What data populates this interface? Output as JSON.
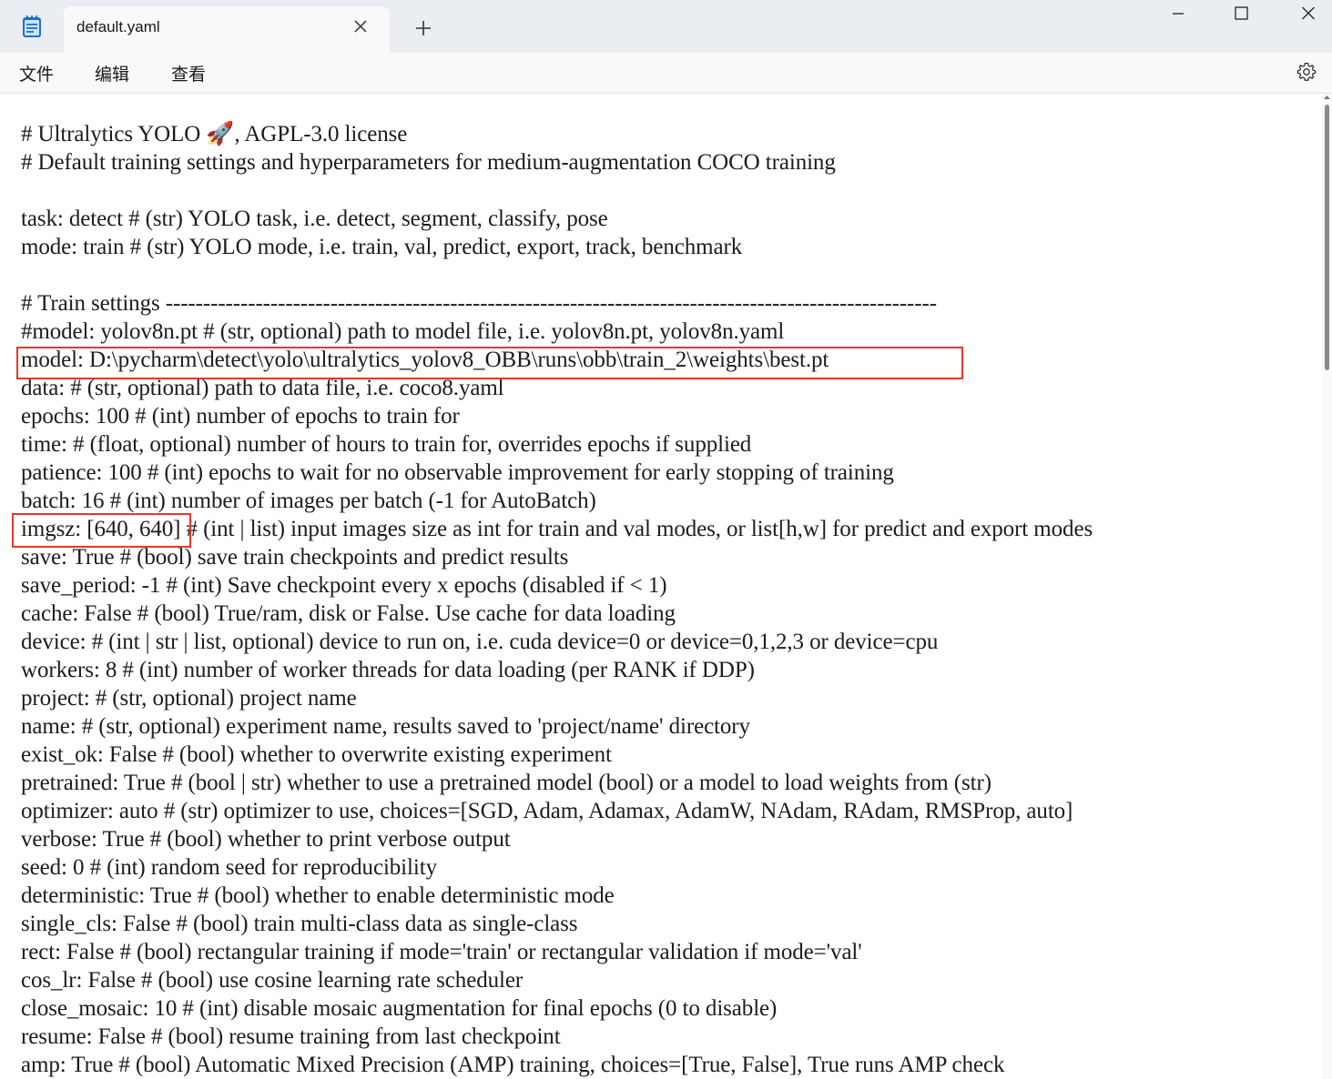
{
  "titlebar": {
    "tab_title": "default.yaml",
    "new_tab_symbol": "+",
    "icons": [
      "notepad-app-icon",
      "close-icon",
      "plus-icon",
      "minimize-icon",
      "maximize-icon",
      "window-close-icon"
    ]
  },
  "menu": {
    "file": "文件",
    "edit": "编辑",
    "view": "查看",
    "settings_icon": "gear-icon"
  },
  "highlight_color": "#e53a23",
  "editor": {
    "lines": [
      "# Ultralytics YOLO 🚀, AGPL-3.0 license",
      "# Default training settings and hyperparameters for medium-augmentation COCO training",
      "",
      "task: detect # (str) YOLO task, i.e. detect, segment, classify, pose",
      "mode: train # (str) YOLO mode, i.e. train, val, predict, export, track, benchmark",
      "",
      "# Train settings -------------------------------------------------------------------------------------------------------",
      "#model: yolov8n.pt # (str, optional) path to model file, i.e. yolov8n.pt, yolov8n.yaml",
      "model: D:\\pycharm\\detect\\yolo\\ultralytics_yolov8_OBB\\runs\\obb\\train_2\\weights\\best.pt",
      "data: # (str, optional) path to data file, i.e. coco8.yaml",
      "epochs: 100 # (int) number of epochs to train for",
      "time: # (float, optional) number of hours to train for, overrides epochs if supplied",
      "patience: 100 # (int) epochs to wait for no observable improvement for early stopping of training",
      "batch: 16 # (int) number of images per batch (-1 for AutoBatch)",
      "imgsz: [640, 640] # (int | list) input images size as int for train and val modes, or list[h,w] for predict and export modes",
      "save: True # (bool) save train checkpoints and predict results",
      "save_period: -1 # (int) Save checkpoint every x epochs (disabled if < 1)",
      "cache: False # (bool) True/ram, disk or False. Use cache for data loading",
      "device: # (int | str | list, optional) device to run on, i.e. cuda device=0 or device=0,1,2,3 or device=cpu",
      "workers: 8 # (int) number of worker threads for data loading (per RANK if DDP)",
      "project: # (str, optional) project name",
      "name: # (str, optional) experiment name, results saved to 'project/name' directory",
      "exist_ok: False # (bool) whether to overwrite existing experiment",
      "pretrained: True # (bool | str) whether to use a pretrained model (bool) or a model to load weights from (str)",
      "optimizer: auto # (str) optimizer to use, choices=[SGD, Adam, Adamax, AdamW, NAdam, RAdam, RMSProp, auto]",
      "verbose: True # (bool) whether to print verbose output",
      "seed: 0 # (int) random seed for reproducibility",
      "deterministic: True # (bool) whether to enable deterministic mode",
      "single_cls: False # (bool) train multi-class data as single-class",
      "rect: False # (bool) rectangular training if mode='train' or rectangular validation if mode='val'",
      "cos_lr: False # (bool) use cosine learning rate scheduler",
      "close_mosaic: 10 # (int) disable mosaic augmentation for final epochs (0 to disable)",
      "resume: False # (bool) resume training from last checkpoint",
      "amp: True # (bool) Automatic Mixed Precision (AMP) training, choices=[True, False], True runs AMP check"
    ]
  }
}
